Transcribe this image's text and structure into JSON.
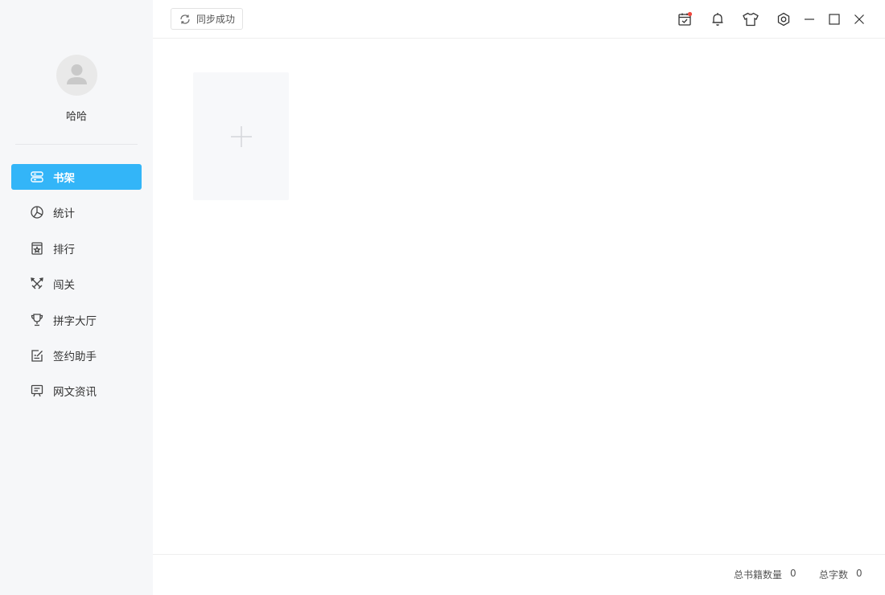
{
  "user": {
    "name": "哈哈"
  },
  "nav": {
    "items": [
      {
        "label": "书架",
        "icon": "bookshelf-icon",
        "active": true
      },
      {
        "label": "统计",
        "icon": "pie-chart-icon"
      },
      {
        "label": "排行",
        "icon": "ranking-icon"
      },
      {
        "label": "闯关",
        "icon": "crossed-swords-icon"
      },
      {
        "label": "拼字大厅",
        "icon": "trophy-icon"
      },
      {
        "label": "签约助手",
        "icon": "contract-edit-icon"
      },
      {
        "label": "网文资讯",
        "icon": "news-board-icon"
      }
    ]
  },
  "toolbar": {
    "sync_label": "同步成功",
    "icons": [
      "calendar-check-icon",
      "bell-icon",
      "tshirt-icon",
      "settings-icon",
      "minimize-icon",
      "maximize-icon",
      "close-icon"
    ]
  },
  "footer": {
    "total_books_label": "总书籍数量",
    "total_books_value": "0",
    "total_words_label": "总字数",
    "total_words_value": "0"
  },
  "colors": {
    "accent": "#33b5f8",
    "sidebar_bg": "#f6f7f9",
    "notification_dot": "#f0483e"
  }
}
